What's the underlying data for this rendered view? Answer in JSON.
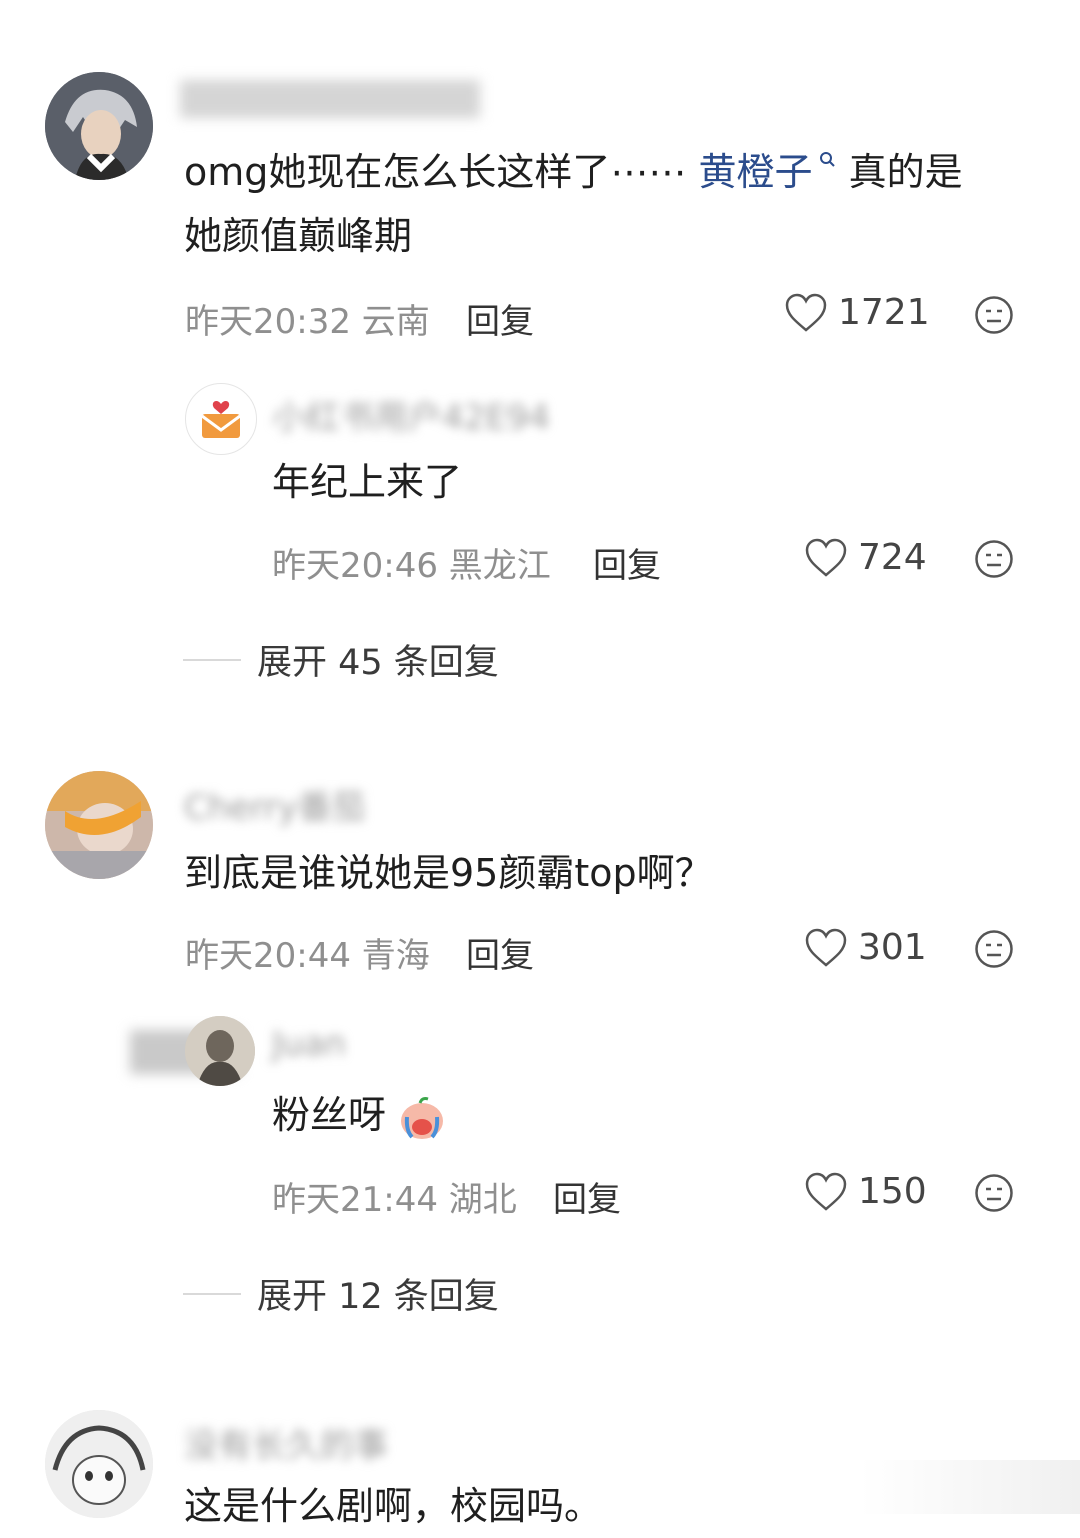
{
  "comments": [
    {
      "text_parts": [
        "omg她现在怎么长这样了⋯⋯ ",
        "黄橙子",
        " 真的是",
        "她颜值巅峰期"
      ],
      "meta": "昨天20:32 云南",
      "reply_label": "回复",
      "likes": "1721",
      "reply": {
        "name": "小红书用户42E94",
        "text": "年纪上来了",
        "meta": "昨天20:46 黑龙江",
        "reply_label": "回复",
        "likes": "724"
      },
      "expand_label": "展开 45 条回复"
    },
    {
      "name": "Cherry番茄",
      "text": "到底是谁说她是95颜霸top啊？",
      "meta": "昨天20:44 青海",
      "reply_label": "回复",
      "likes": "301",
      "reply": {
        "name": "Juan",
        "text": "粉丝呀",
        "meta": "昨天21:44 湖北",
        "reply_label": "回复",
        "likes": "150"
      },
      "expand_label": "展开 12 条回复"
    },
    {
      "name": "没有长久的事",
      "text": "这是什么剧啊，校园吗。"
    }
  ],
  "icons": {
    "like": "heart-outline-icon",
    "dislike": "unhappy-face-icon",
    "search": "search-icon"
  },
  "colors": {
    "mention": "#2b4c8c",
    "meta": "#8f8f8f"
  }
}
